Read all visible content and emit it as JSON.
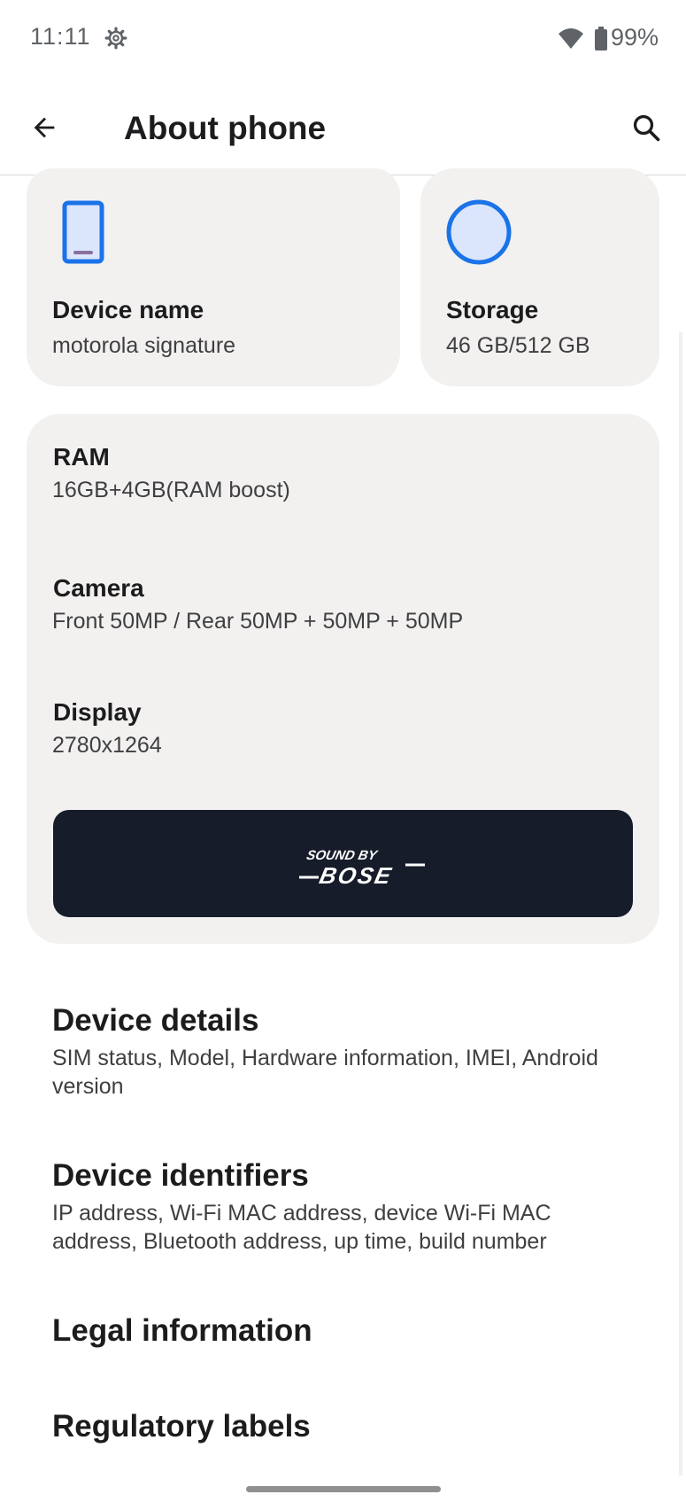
{
  "status_bar": {
    "time": "11:11",
    "battery": "99%"
  },
  "app_bar": {
    "title": "About phone"
  },
  "device_card": {
    "title": "Device name",
    "value": "motorola signature"
  },
  "storage_card": {
    "title": "Storage",
    "value": "46 GB/512 GB"
  },
  "specs": {
    "ram": {
      "title": "RAM",
      "value": "16GB+4GB(RAM boost)"
    },
    "camera": {
      "title": "Camera",
      "value": "Front 50MP / Rear 50MP + 50MP + 50MP"
    },
    "display": {
      "title": "Display",
      "value": "2780x1264"
    }
  },
  "bose": {
    "line1": "SOUND BY",
    "line2": "BOSE"
  },
  "list": [
    {
      "title": "Device details",
      "subtitle": "SIM status, Model, Hardware information, IMEI, Android version"
    },
    {
      "title": "Device identifiers",
      "subtitle": "IP address, Wi-Fi MAC address, device Wi-Fi MAC address, Bluetooth address, up time, build number"
    },
    {
      "title": "Legal information"
    },
    {
      "title": "Regulatory labels"
    }
  ],
  "colors": {
    "card_bg": "#f2f1ef",
    "accent_blue": "#1a73e8",
    "bose_bg": "#161c2a"
  }
}
